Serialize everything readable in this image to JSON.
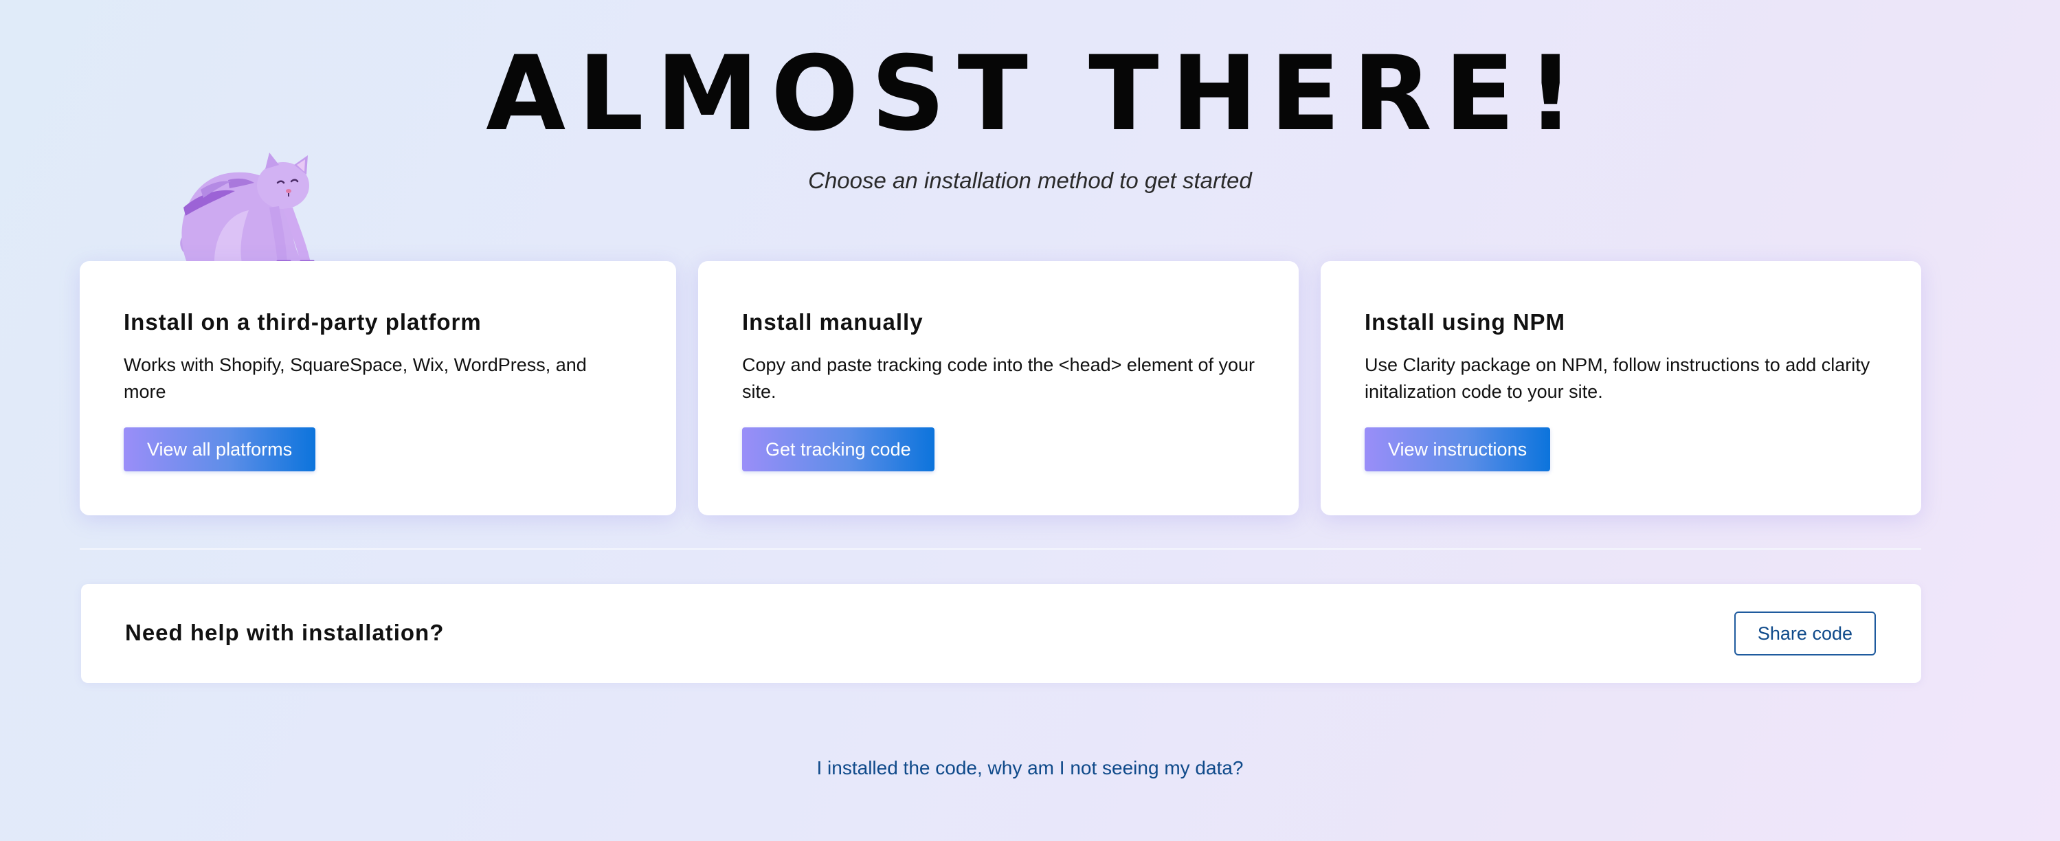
{
  "hero": {
    "title": "ALMOST THERE!",
    "subtitle": "Choose an installation method to get started"
  },
  "mascot": {
    "icon": "cat-mascot-icon",
    "color": "#c9a8ef"
  },
  "cards": [
    {
      "title": "Install on a third-party platform",
      "description": "Works with Shopify, SquareSpace, Wix, WordPress, and more",
      "button_label": "View all platforms"
    },
    {
      "title": "Install manually",
      "description": "Copy and paste tracking code into the <head> element of your site.",
      "button_label": "Get tracking code"
    },
    {
      "title": "Install using NPM",
      "description": "Use Clarity package on NPM, follow instructions to add clarity initalization code to your site.",
      "button_label": "View instructions"
    }
  ],
  "help": {
    "text": "Need help with installation?",
    "button_label": "Share code"
  },
  "footer": {
    "link_text": "I installed the code, why am I not seeing my data?"
  },
  "colors": {
    "button_gradient_start": "#9a8ef8",
    "button_gradient_end": "#0c74dc",
    "link": "#0f4a8a"
  }
}
